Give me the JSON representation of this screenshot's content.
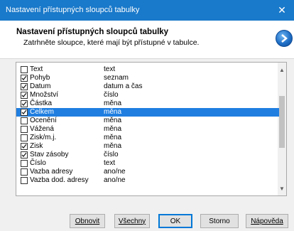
{
  "window": {
    "title": "Nastavení přístupných sloupců tabulky",
    "close_glyph": "✕"
  },
  "header": {
    "title": "Nastavení přístupných sloupců tabulky",
    "subtitle": "Zatrhněte sloupce, které mají být přístupné v tabulce.",
    "logo_icon": "chevron-right-circle-icon"
  },
  "list": {
    "rows": [
      {
        "name": "Text",
        "type": "text",
        "checked": false,
        "selected": false
      },
      {
        "name": "Pohyb",
        "type": "seznam",
        "checked": true,
        "selected": false
      },
      {
        "name": "Datum",
        "type": "datum a čas",
        "checked": true,
        "selected": false
      },
      {
        "name": "Množství",
        "type": "číslo",
        "checked": true,
        "selected": false
      },
      {
        "name": "Částka",
        "type": "měna",
        "checked": true,
        "selected": false
      },
      {
        "name": "Celkem",
        "type": "měna",
        "checked": true,
        "selected": true
      },
      {
        "name": "Ocenění",
        "type": "měna",
        "checked": false,
        "selected": false
      },
      {
        "name": "Vážená",
        "type": "měna",
        "checked": false,
        "selected": false
      },
      {
        "name": "Zisk/m.j.",
        "type": "měna",
        "checked": false,
        "selected": false
      },
      {
        "name": "Zisk",
        "type": "měna",
        "checked": true,
        "selected": false
      },
      {
        "name": "Stav zásoby",
        "type": "číslo",
        "checked": true,
        "selected": false
      },
      {
        "name": "Číslo",
        "type": "text",
        "checked": false,
        "selected": false
      },
      {
        "name": "Vazba adresy",
        "type": "ano/ne",
        "checked": false,
        "selected": false
      },
      {
        "name": "Vazba dod. adresy",
        "type": "ano/ne",
        "checked": false,
        "selected": false
      }
    ]
  },
  "buttons": {
    "obnovit": "Obnovit",
    "vsechny": "Všechny",
    "ok": "OK",
    "storno": "Storno",
    "napoveda": "Nápověda"
  },
  "colors": {
    "titlebar": "#1979ca",
    "selection": "#1f7ee0"
  }
}
